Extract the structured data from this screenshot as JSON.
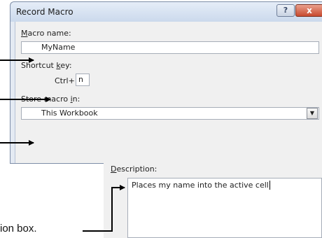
{
  "dialog": {
    "title": "Record Macro",
    "help_label": "?",
    "close_label": "x",
    "macro_name_label_u": "M",
    "macro_name_label_rest": "acro name:",
    "macro_name_value": "MyName",
    "shortcut_label_pre": "Shortcut ",
    "shortcut_label_u": "k",
    "shortcut_label_post": "ey:",
    "shortcut_prefix": "Ctrl+",
    "shortcut_value": "n",
    "store_label_pre": "Store macro ",
    "store_label_u": "i",
    "store_label_post": "n:",
    "store_value": "This Workbook",
    "store_dropdown_icon": "chevron-down-icon"
  },
  "description": {
    "label_u": "D",
    "label_rest": "escription:",
    "value": "Places my name into the active cell"
  },
  "caption": {
    "text": "ion box."
  }
}
